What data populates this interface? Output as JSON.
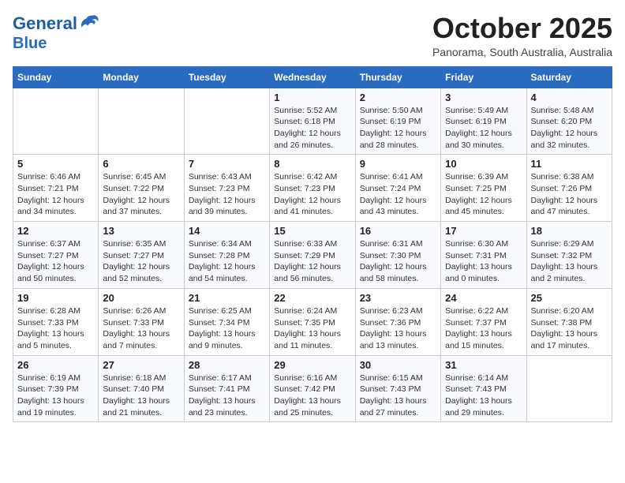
{
  "header": {
    "logo_line1": "General",
    "logo_line2": "Blue",
    "month_title": "October 2025",
    "location": "Panorama, South Australia, Australia"
  },
  "days_of_week": [
    "Sunday",
    "Monday",
    "Tuesday",
    "Wednesday",
    "Thursday",
    "Friday",
    "Saturday"
  ],
  "weeks": [
    [
      {
        "day": "",
        "info": ""
      },
      {
        "day": "",
        "info": ""
      },
      {
        "day": "",
        "info": ""
      },
      {
        "day": "1",
        "info": "Sunrise: 5:52 AM\nSunset: 6:18 PM\nDaylight: 12 hours\nand 26 minutes."
      },
      {
        "day": "2",
        "info": "Sunrise: 5:50 AM\nSunset: 6:19 PM\nDaylight: 12 hours\nand 28 minutes."
      },
      {
        "day": "3",
        "info": "Sunrise: 5:49 AM\nSunset: 6:19 PM\nDaylight: 12 hours\nand 30 minutes."
      },
      {
        "day": "4",
        "info": "Sunrise: 5:48 AM\nSunset: 6:20 PM\nDaylight: 12 hours\nand 32 minutes."
      }
    ],
    [
      {
        "day": "5",
        "info": "Sunrise: 6:46 AM\nSunset: 7:21 PM\nDaylight: 12 hours\nand 34 minutes."
      },
      {
        "day": "6",
        "info": "Sunrise: 6:45 AM\nSunset: 7:22 PM\nDaylight: 12 hours\nand 37 minutes."
      },
      {
        "day": "7",
        "info": "Sunrise: 6:43 AM\nSunset: 7:23 PM\nDaylight: 12 hours\nand 39 minutes."
      },
      {
        "day": "8",
        "info": "Sunrise: 6:42 AM\nSunset: 7:23 PM\nDaylight: 12 hours\nand 41 minutes."
      },
      {
        "day": "9",
        "info": "Sunrise: 6:41 AM\nSunset: 7:24 PM\nDaylight: 12 hours\nand 43 minutes."
      },
      {
        "day": "10",
        "info": "Sunrise: 6:39 AM\nSunset: 7:25 PM\nDaylight: 12 hours\nand 45 minutes."
      },
      {
        "day": "11",
        "info": "Sunrise: 6:38 AM\nSunset: 7:26 PM\nDaylight: 12 hours\nand 47 minutes."
      }
    ],
    [
      {
        "day": "12",
        "info": "Sunrise: 6:37 AM\nSunset: 7:27 PM\nDaylight: 12 hours\nand 50 minutes."
      },
      {
        "day": "13",
        "info": "Sunrise: 6:35 AM\nSunset: 7:27 PM\nDaylight: 12 hours\nand 52 minutes."
      },
      {
        "day": "14",
        "info": "Sunrise: 6:34 AM\nSunset: 7:28 PM\nDaylight: 12 hours\nand 54 minutes."
      },
      {
        "day": "15",
        "info": "Sunrise: 6:33 AM\nSunset: 7:29 PM\nDaylight: 12 hours\nand 56 minutes."
      },
      {
        "day": "16",
        "info": "Sunrise: 6:31 AM\nSunset: 7:30 PM\nDaylight: 12 hours\nand 58 minutes."
      },
      {
        "day": "17",
        "info": "Sunrise: 6:30 AM\nSunset: 7:31 PM\nDaylight: 13 hours\nand 0 minutes."
      },
      {
        "day": "18",
        "info": "Sunrise: 6:29 AM\nSunset: 7:32 PM\nDaylight: 13 hours\nand 2 minutes."
      }
    ],
    [
      {
        "day": "19",
        "info": "Sunrise: 6:28 AM\nSunset: 7:33 PM\nDaylight: 13 hours\nand 5 minutes."
      },
      {
        "day": "20",
        "info": "Sunrise: 6:26 AM\nSunset: 7:33 PM\nDaylight: 13 hours\nand 7 minutes."
      },
      {
        "day": "21",
        "info": "Sunrise: 6:25 AM\nSunset: 7:34 PM\nDaylight: 13 hours\nand 9 minutes."
      },
      {
        "day": "22",
        "info": "Sunrise: 6:24 AM\nSunset: 7:35 PM\nDaylight: 13 hours\nand 11 minutes."
      },
      {
        "day": "23",
        "info": "Sunrise: 6:23 AM\nSunset: 7:36 PM\nDaylight: 13 hours\nand 13 minutes."
      },
      {
        "day": "24",
        "info": "Sunrise: 6:22 AM\nSunset: 7:37 PM\nDaylight: 13 hours\nand 15 minutes."
      },
      {
        "day": "25",
        "info": "Sunrise: 6:20 AM\nSunset: 7:38 PM\nDaylight: 13 hours\nand 17 minutes."
      }
    ],
    [
      {
        "day": "26",
        "info": "Sunrise: 6:19 AM\nSunset: 7:39 PM\nDaylight: 13 hours\nand 19 minutes."
      },
      {
        "day": "27",
        "info": "Sunrise: 6:18 AM\nSunset: 7:40 PM\nDaylight: 13 hours\nand 21 minutes."
      },
      {
        "day": "28",
        "info": "Sunrise: 6:17 AM\nSunset: 7:41 PM\nDaylight: 13 hours\nand 23 minutes."
      },
      {
        "day": "29",
        "info": "Sunrise: 6:16 AM\nSunset: 7:42 PM\nDaylight: 13 hours\nand 25 minutes."
      },
      {
        "day": "30",
        "info": "Sunrise: 6:15 AM\nSunset: 7:43 PM\nDaylight: 13 hours\nand 27 minutes."
      },
      {
        "day": "31",
        "info": "Sunrise: 6:14 AM\nSunset: 7:43 PM\nDaylight: 13 hours\nand 29 minutes."
      },
      {
        "day": "",
        "info": ""
      }
    ]
  ]
}
